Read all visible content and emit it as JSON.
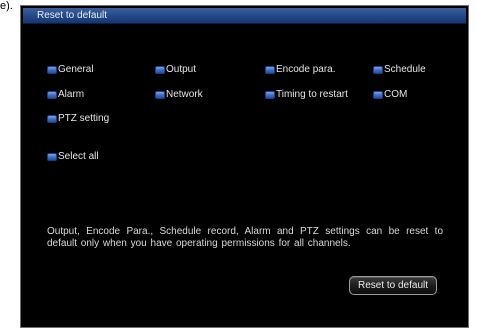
{
  "stray_text": "e).",
  "dialog": {
    "title": "Reset to default",
    "options": [
      {
        "label": "General",
        "checked": true
      },
      {
        "label": "Output",
        "checked": true
      },
      {
        "label": "Encode para.",
        "checked": true
      },
      {
        "label": "Schedule",
        "checked": true
      },
      {
        "label": "Alarm",
        "checked": true
      },
      {
        "label": "Network",
        "checked": true
      },
      {
        "label": "Timing to restart",
        "checked": true
      },
      {
        "label": "COM",
        "checked": true
      },
      {
        "label": "PTZ setting",
        "checked": true
      }
    ],
    "select_all": {
      "label": "Select all",
      "checked": true
    },
    "notice": "Output, Encode Para., Schedule record, Alarm and PTZ settings can be reset to default only when you have operating permissions for all channels.",
    "reset_button_label": "Reset to default"
  },
  "colors": {
    "window_background": "#000000",
    "titlebar": "#254a88",
    "checkbox_checked": "#3f6fc8",
    "text": "#e4e4e4"
  }
}
